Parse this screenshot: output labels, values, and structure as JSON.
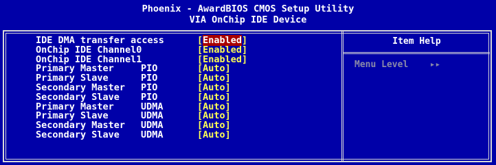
{
  "header": {
    "line1": "Phoenix - AwardBIOS CMOS Setup Utility",
    "line2": "VIA OnChip IDE Device"
  },
  "help": {
    "title": "Item Help",
    "menu_level_label": "Menu Level",
    "menu_level_value": "▸▸"
  },
  "items": [
    {
      "label": "IDE DMA transfer access",
      "mode": "",
      "value": "Enabled",
      "selected": true
    },
    {
      "label": "OnChip IDE Channel0",
      "mode": "",
      "value": "Enabled",
      "selected": false
    },
    {
      "label": "OnChip IDE Channel1",
      "mode": "",
      "value": "Enabled",
      "selected": false
    },
    {
      "label": "Primary Master",
      "mode": "PIO",
      "value": "Auto",
      "selected": false
    },
    {
      "label": "Primary Slave",
      "mode": "PIO",
      "value": "Auto",
      "selected": false
    },
    {
      "label": "Secondary Master",
      "mode": "PIO",
      "value": "Auto",
      "selected": false
    },
    {
      "label": "Secondary Slave",
      "mode": "PIO",
      "value": "Auto",
      "selected": false
    },
    {
      "label": "Primary Master",
      "mode": "UDMA",
      "value": "Auto",
      "selected": false
    },
    {
      "label": "Primary Slave",
      "mode": "UDMA",
      "value": "Auto",
      "selected": false
    },
    {
      "label": "Secondary Master",
      "mode": "UDMA",
      "value": "Auto",
      "selected": false
    },
    {
      "label": "Secondary Slave",
      "mode": "UDMA",
      "value": "Auto",
      "selected": false
    }
  ]
}
